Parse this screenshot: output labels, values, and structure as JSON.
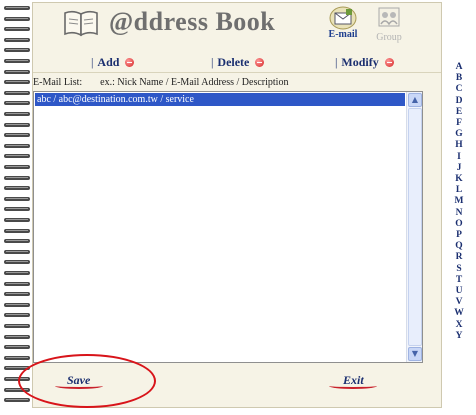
{
  "header": {
    "title": "@ddress Book",
    "email_label": "E-mail",
    "group_label": "Group",
    "book_icon": "book-icon",
    "email_icon": "envelope-icon",
    "group_icon": "group-icon"
  },
  "toolbar": {
    "add_label": "Add",
    "delete_label": "Delete",
    "modify_label": "Modify",
    "separator": "|"
  },
  "list": {
    "label": "E-Mail List:",
    "hint": "ex.: Nick Name / E-Mail Address / Description",
    "items": [
      "abc / abc@destination.com.tw / service"
    ],
    "scroll_up": "▲",
    "scroll_down": "▼"
  },
  "alphabet": [
    "A",
    "B",
    "C",
    "D",
    "E",
    "F",
    "G",
    "H",
    "I",
    "J",
    "K",
    "L",
    "M",
    "N",
    "O",
    "P",
    "Q",
    "R",
    "S",
    "T",
    "U",
    "V",
    "W",
    "X",
    "Y"
  ],
  "footer": {
    "save_label": "Save",
    "exit_label": "Exit"
  },
  "colors": {
    "accent": "#1b2f70",
    "selection": "#2e57c7",
    "highlight": "#d8141a",
    "page": "#f6f3e6"
  }
}
